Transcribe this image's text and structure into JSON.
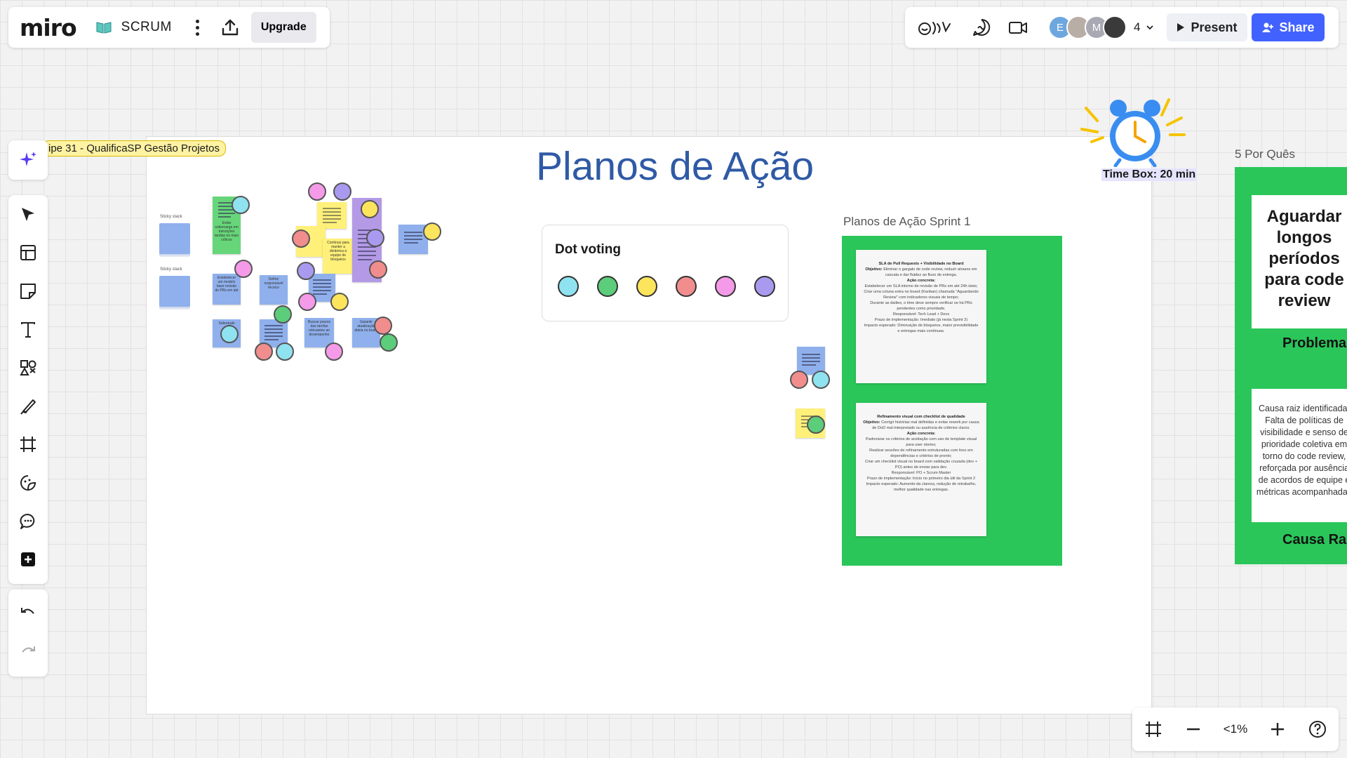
{
  "app": {
    "logo": "miro",
    "board_name": "SCRUM",
    "upgrade_label": "Upgrade"
  },
  "header": {
    "collaborators": [
      "E",
      "M"
    ],
    "collaborator_count": "4",
    "present_label": "Present",
    "share_label": "Share",
    "accent_color": "#4262ff"
  },
  "toolbar": {
    "tools": [
      "ai-sparkle-icon",
      "select-cursor-icon",
      "templates-icon",
      "sticky-note-icon",
      "text-icon",
      "shapes-icon",
      "pen-icon",
      "frame-icon",
      "stickers-icon",
      "comment-icon",
      "more-apps-icon",
      "undo-icon",
      "redo-icon"
    ]
  },
  "zoom": {
    "level": "<1%"
  },
  "canvas": {
    "frame_label": "ipe 31 - QualificaSP Gestão Projetos",
    "title": "Planos de Ação",
    "stack_label": "Sticky stack",
    "stickies": [
      "Evitar sobrecarga em transições tardias no mais críticos",
      "Estabelecer um modelo base revisão de PRs em até",
      "Definir responsável técnico",
      "Sobretudo",
      "Contínuo para manter a dinâmica à equipe de bloqueios",
      "Buscar prazos das tarefas relevantes ao desempenho",
      "Garantir atualização diária no board"
    ],
    "dot_voting": {
      "title": "Dot voting",
      "colors": [
        "#8fe2f0",
        "#5ccd7a",
        "#fde45d",
        "#f18d8d",
        "#f59ae8",
        "#a99af0"
      ]
    },
    "sprint": {
      "label": "Planos de Ação Sprint 1",
      "plan1": {
        "title": "SLA de Pull Requests + Visibilidade no Board",
        "objective_label": "Objetivo:",
        "objective": "Eliminar o gargalo de code review, reduzir atrasos em cascata e dar fluidez ao fluxo de entrega.",
        "action_label": "Ação concreta:",
        "items": [
          "Estabelecer um SLA interno de revisão de PRs em até 24h úteis;",
          "Criar uma coluna extra no board (Kanban) chamada \"Aguardando Review\" com indicadores visuais de tempo;",
          "Durante as dailies, o time deve sempre verificar se há PRs pendentes como prioridade."
        ],
        "responsible": "Responsável: Tech Lead + Devs",
        "deadline": "Prazo de implementação: Imediato (já nesta Sprint 2)",
        "impact": "Impacto esperado: Diminuição de bloqueios, maior previsibilidade e entregas mais contínuas."
      },
      "plan2": {
        "title": "Refinamento visual com checklist de qualidade",
        "objective_label": "Objetivo:",
        "objective": "Corrigir histórias mal definidas e evitar rework por causa de DoD mal interpretado ou ausência de critérios claros.",
        "action_label": "Ação concreta:",
        "items": [
          "Padronizar os critérios de aceitação com uso de template visual para user stories;",
          "Realizar sessões de refinamento estruturadas com foco em dependências e critérios de pronto;",
          "Criar um checklist visual no board com validação cruzada (dev + PO) antes de enviar para dev."
        ],
        "responsible": "Responsável: PO + Scrum Master",
        "deadline": "Prazo de implementação: Início no primeiro dia útil da Sprint 2",
        "impact": "Impacto esperado: Aumento da clareza, redução de retrabalho, melhor qualidade nas entregas."
      }
    },
    "timebox": "Time Box: 20 min",
    "por_ques": {
      "label": "5 Por Quês",
      "card1": "Aguardar longos períodos para code review",
      "problem_label": "Problema",
      "card2": "Causa raiz identificada: Falta de políticas de visibilidade e senso de prioridade coletiva em torno do code review, reforçada por ausência de acordos de equipe e métricas acompanhadas",
      "cause_label": "Causa Raiz"
    }
  }
}
